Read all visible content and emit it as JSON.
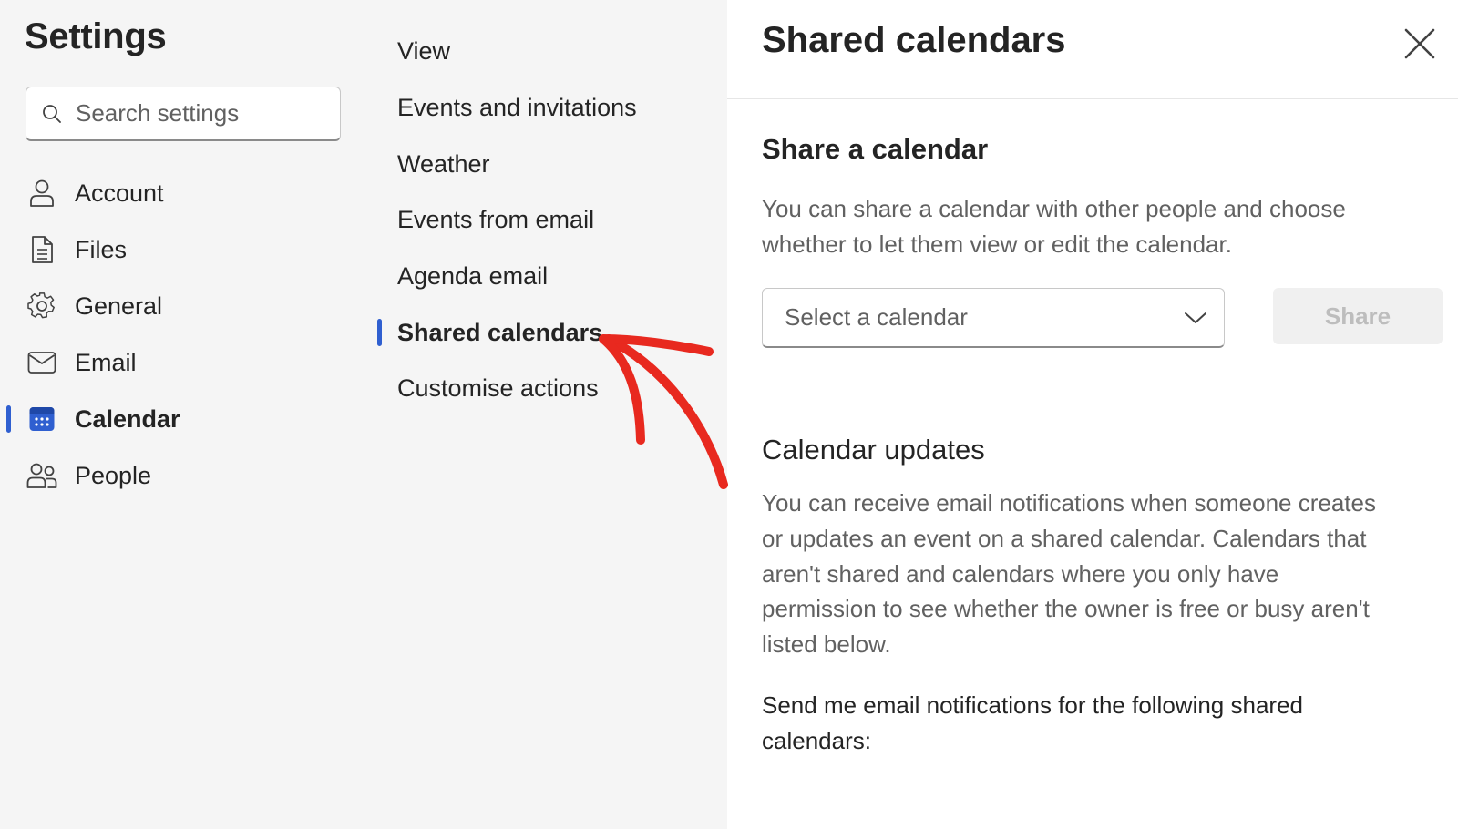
{
  "settings": {
    "title": "Settings",
    "search_placeholder": "Search settings"
  },
  "nav": {
    "items": [
      {
        "label": "Account",
        "icon": "person-icon"
      },
      {
        "label": "Files",
        "icon": "document-icon"
      },
      {
        "label": "General",
        "icon": "gear-icon"
      },
      {
        "label": "Email",
        "icon": "envelope-icon"
      },
      {
        "label": "Calendar",
        "icon": "calendar-icon",
        "selected": true
      },
      {
        "label": "People",
        "icon": "people-icon"
      }
    ]
  },
  "subnav": {
    "items": [
      {
        "label": "View"
      },
      {
        "label": "Events and invitations"
      },
      {
        "label": "Weather"
      },
      {
        "label": "Events from email"
      },
      {
        "label": "Agenda email"
      },
      {
        "label": "Shared calendars",
        "selected": true
      },
      {
        "label": "Customise actions"
      }
    ]
  },
  "panel": {
    "title": "Shared calendars",
    "share_heading": "Share a calendar",
    "share_description": "You can share a calendar with other people and choose whether to let them view or edit the calendar.",
    "select_placeholder": "Select a calendar",
    "share_button": "Share",
    "updates_heading": "Calendar updates",
    "updates_description": "You can receive email notifications when someone creates or updates an event on a shared calendar. Calendars that aren't shared and calendars where you only have permission to see whether the owner is free or busy aren't listed below.",
    "notifications_text": "Send me email notifications for the following shared calendars:"
  },
  "colors": {
    "accent": "#2f5fd0",
    "annotation": "#e8291f",
    "pane_bg": "#f5f5f5"
  }
}
